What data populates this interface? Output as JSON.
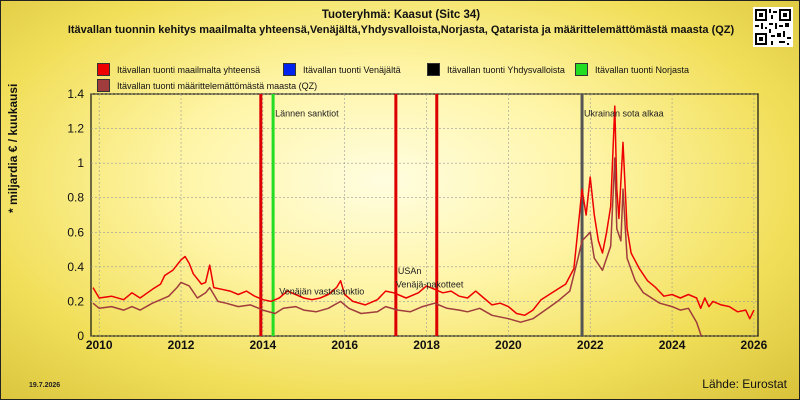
{
  "title": "Tuoteryhmä: Kaasut (Sitc 34)",
  "subtitle": "Itävallan tuonnin kehitys maailmalta yhteensä,Venäjältä,Yhdysvalloista,Norjasta, Qatarista ja määrittelemättömästä maasta (QZ)",
  "date": "19.7.2026",
  "source": "Lähde: Eurostat",
  "colors": {
    "red": "#ee0000",
    "blue": "#0022ee",
    "black": "#000000",
    "green": "#22dd22",
    "brown": "#a03c3c",
    "event_red": "#dd0000",
    "event_grey": "#555555"
  },
  "chart_data": {
    "type": "line",
    "ylabel": "* miljardia € / kuukausi",
    "xlabel": "",
    "xlim": [
      2009.8,
      2026.1
    ],
    "ylim": [
      0,
      1.4
    ],
    "x_ticks": [
      "2010",
      "2012",
      "2014",
      "2016",
      "2018",
      "2020",
      "2022",
      "2024",
      "2026"
    ],
    "y_ticks": [
      "0",
      "0.2",
      "0.4",
      "0.6",
      "0.8",
      "1",
      "1.2",
      "1.4"
    ],
    "grid": true,
    "legend_position": "top",
    "series": [
      {
        "name": "Itävallan tuonti maailmalta yhteensä",
        "color": "#ee0000",
        "points": [
          [
            2009.85,
            0.28
          ],
          [
            2010.0,
            0.22
          ],
          [
            2010.3,
            0.23
          ],
          [
            2010.6,
            0.21
          ],
          [
            2010.8,
            0.25
          ],
          [
            2011.0,
            0.22
          ],
          [
            2011.3,
            0.27
          ],
          [
            2011.5,
            0.3
          ],
          [
            2011.6,
            0.35
          ],
          [
            2011.8,
            0.38
          ],
          [
            2012.0,
            0.44
          ],
          [
            2012.1,
            0.46
          ],
          [
            2012.2,
            0.42
          ],
          [
            2012.3,
            0.36
          ],
          [
            2012.5,
            0.3
          ],
          [
            2012.6,
            0.31
          ],
          [
            2012.7,
            0.41
          ],
          [
            2012.8,
            0.28
          ],
          [
            2013.0,
            0.27
          ],
          [
            2013.2,
            0.26
          ],
          [
            2013.4,
            0.24
          ],
          [
            2013.6,
            0.26
          ],
          [
            2013.8,
            0.23
          ],
          [
            2014.0,
            0.21
          ],
          [
            2014.2,
            0.2
          ],
          [
            2014.4,
            0.22
          ],
          [
            2014.6,
            0.26
          ],
          [
            2014.8,
            0.24
          ],
          [
            2015.0,
            0.22
          ],
          [
            2015.2,
            0.21
          ],
          [
            2015.4,
            0.22
          ],
          [
            2015.6,
            0.24
          ],
          [
            2015.8,
            0.28
          ],
          [
            2015.9,
            0.32
          ],
          [
            2016.0,
            0.24
          ],
          [
            2016.2,
            0.2
          ],
          [
            2016.5,
            0.18
          ],
          [
            2016.8,
            0.21
          ],
          [
            2017.0,
            0.26
          ],
          [
            2017.2,
            0.25
          ],
          [
            2017.5,
            0.22
          ],
          [
            2017.8,
            0.25
          ],
          [
            2018.0,
            0.29
          ],
          [
            2018.2,
            0.27
          ],
          [
            2018.4,
            0.25
          ],
          [
            2018.6,
            0.26
          ],
          [
            2018.8,
            0.23
          ],
          [
            2019.0,
            0.22
          ],
          [
            2019.2,
            0.26
          ],
          [
            2019.4,
            0.22
          ],
          [
            2019.6,
            0.18
          ],
          [
            2019.8,
            0.19
          ],
          [
            2020.0,
            0.17
          ],
          [
            2020.2,
            0.13
          ],
          [
            2020.4,
            0.12
          ],
          [
            2020.6,
            0.15
          ],
          [
            2020.8,
            0.21
          ],
          [
            2021.0,
            0.24
          ],
          [
            2021.2,
            0.27
          ],
          [
            2021.4,
            0.3
          ],
          [
            2021.6,
            0.39
          ],
          [
            2021.7,
            0.62
          ],
          [
            2021.8,
            0.85
          ],
          [
            2021.9,
            0.7
          ],
          [
            2022.0,
            0.92
          ],
          [
            2022.1,
            0.7
          ],
          [
            2022.2,
            0.55
          ],
          [
            2022.3,
            0.48
          ],
          [
            2022.4,
            0.6
          ],
          [
            2022.5,
            0.75
          ],
          [
            2022.6,
            1.33
          ],
          [
            2022.65,
            0.85
          ],
          [
            2022.7,
            0.68
          ],
          [
            2022.8,
            1.12
          ],
          [
            2022.9,
            0.62
          ],
          [
            2023.0,
            0.48
          ],
          [
            2023.2,
            0.39
          ],
          [
            2023.4,
            0.32
          ],
          [
            2023.6,
            0.28
          ],
          [
            2023.8,
            0.23
          ],
          [
            2024.0,
            0.24
          ],
          [
            2024.2,
            0.22
          ],
          [
            2024.4,
            0.24
          ],
          [
            2024.6,
            0.22
          ],
          [
            2024.7,
            0.16
          ],
          [
            2024.8,
            0.22
          ],
          [
            2024.9,
            0.17
          ],
          [
            2025.0,
            0.2
          ],
          [
            2025.2,
            0.18
          ],
          [
            2025.4,
            0.17
          ],
          [
            2025.6,
            0.14
          ],
          [
            2025.8,
            0.15
          ],
          [
            2025.9,
            0.1
          ],
          [
            2026.0,
            0.15
          ]
        ]
      },
      {
        "name": "Itävallan tuonti Venäjältä",
        "color": "#0022ee",
        "points": []
      },
      {
        "name": "Itävallan tuonti Yhdysvalloista",
        "color": "#000000",
        "points": []
      },
      {
        "name": "Itävallan tuonti Norjasta",
        "color": "#22dd22",
        "points": []
      },
      {
        "name": "Itävallan tuonti määrittelemättömästä maasta (QZ)",
        "color": "#a03c3c",
        "points": [
          [
            2009.85,
            0.19
          ],
          [
            2010.0,
            0.16
          ],
          [
            2010.3,
            0.17
          ],
          [
            2010.6,
            0.15
          ],
          [
            2010.8,
            0.17
          ],
          [
            2011.0,
            0.15
          ],
          [
            2011.3,
            0.19
          ],
          [
            2011.5,
            0.21
          ],
          [
            2011.7,
            0.23
          ],
          [
            2011.9,
            0.28
          ],
          [
            2012.0,
            0.31
          ],
          [
            2012.2,
            0.29
          ],
          [
            2012.4,
            0.22
          ],
          [
            2012.6,
            0.25
          ],
          [
            2012.7,
            0.28
          ],
          [
            2012.9,
            0.2
          ],
          [
            2013.1,
            0.19
          ],
          [
            2013.4,
            0.17
          ],
          [
            2013.7,
            0.18
          ],
          [
            2014.0,
            0.15
          ],
          [
            2014.3,
            0.13
          ],
          [
            2014.5,
            0.16
          ],
          [
            2014.8,
            0.17
          ],
          [
            2015.0,
            0.15
          ],
          [
            2015.3,
            0.14
          ],
          [
            2015.6,
            0.16
          ],
          [
            2015.9,
            0.2
          ],
          [
            2016.1,
            0.16
          ],
          [
            2016.4,
            0.13
          ],
          [
            2016.8,
            0.14
          ],
          [
            2017.0,
            0.17
          ],
          [
            2017.3,
            0.15
          ],
          [
            2017.6,
            0.14
          ],
          [
            2017.9,
            0.17
          ],
          [
            2018.2,
            0.19
          ],
          [
            2018.5,
            0.16
          ],
          [
            2018.8,
            0.15
          ],
          [
            2019.0,
            0.14
          ],
          [
            2019.3,
            0.16
          ],
          [
            2019.6,
            0.12
          ],
          [
            2020.0,
            0.1
          ],
          [
            2020.3,
            0.08
          ],
          [
            2020.6,
            0.1
          ],
          [
            2020.9,
            0.15
          ],
          [
            2021.2,
            0.2
          ],
          [
            2021.5,
            0.26
          ],
          [
            2021.7,
            0.45
          ],
          [
            2021.8,
            0.55
          ],
          [
            2022.0,
            0.6
          ],
          [
            2022.1,
            0.45
          ],
          [
            2022.3,
            0.38
          ],
          [
            2022.5,
            0.52
          ],
          [
            2022.6,
            1.03
          ],
          [
            2022.65,
            0.62
          ],
          [
            2022.75,
            0.55
          ],
          [
            2022.8,
            0.85
          ],
          [
            2022.9,
            0.45
          ],
          [
            2023.1,
            0.32
          ],
          [
            2023.3,
            0.25
          ],
          [
            2023.5,
            0.22
          ],
          [
            2023.7,
            0.19
          ],
          [
            2024.0,
            0.17
          ],
          [
            2024.2,
            0.15
          ],
          [
            2024.4,
            0.16
          ],
          [
            2024.6,
            0.08
          ],
          [
            2024.7,
            0.01
          ],
          [
            2024.72,
            0.0
          ]
        ]
      }
    ],
    "events": [
      {
        "x": 2013.95,
        "color": "#dd0000",
        "label": ""
      },
      {
        "x": 2014.25,
        "color": "#22dd22",
        "label": "Lännen sanktiot",
        "label_y": 1.27
      },
      {
        "x": 2017.25,
        "color": "#dd0000",
        "label": "USAn",
        "label_y": 0.36
      },
      {
        "x": 2018.25,
        "color": "#dd0000",
        "label": ""
      },
      {
        "x": 2021.8,
        "color": "#555555",
        "label": "Ukrainan sota alkaa",
        "label_y": 1.27
      }
    ],
    "annotations": [
      {
        "text": "Venäjän vastasanktio",
        "x": 2014.4,
        "y": 0.24
      },
      {
        "text": "Venäjä-pakotteet",
        "x": 2017.25,
        "y": 0.28
      }
    ]
  }
}
